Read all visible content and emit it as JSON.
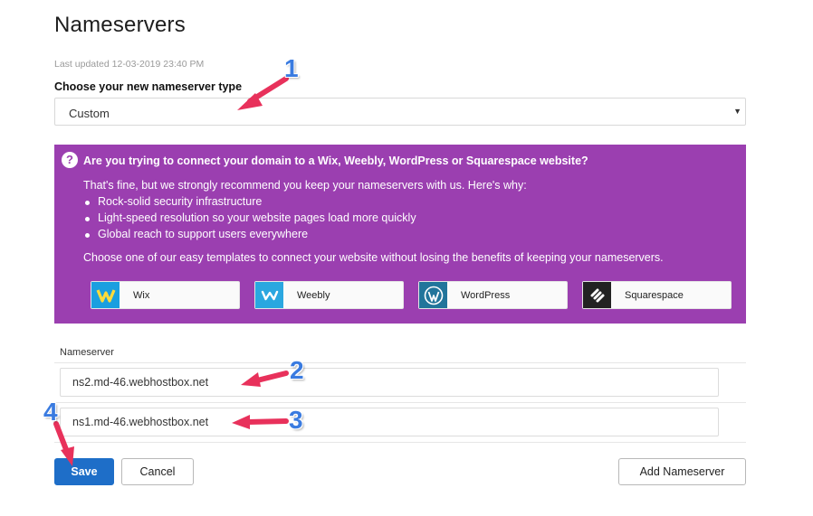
{
  "page": {
    "title": "Nameservers",
    "last_updated": "Last updated 12-03-2019 23:40 PM"
  },
  "nameserver_type": {
    "label": "Choose your new nameserver type",
    "selected": "Custom"
  },
  "promo": {
    "title": "Are you trying to connect your domain to a Wix, Weebly, WordPress or Squarespace website?",
    "intro": "That's fine, but we strongly recommend you keep your nameservers with us. Here's why:",
    "bullets": [
      "Rock-solid security infrastructure",
      "Light-speed resolution so your website pages load more quickly",
      "Global reach to support users everywhere"
    ],
    "choose_text": "Choose one of our easy templates to connect your website without losing the benefits of keeping your nameservers.",
    "templates": [
      {
        "label": "Wix",
        "icon": "wix-icon",
        "color": "#1a9fe0"
      },
      {
        "label": "Weebly",
        "icon": "weebly-icon",
        "color": "#2aa7e0"
      },
      {
        "label": "WordPress",
        "icon": "wordpress-icon",
        "color": "#21759b"
      },
      {
        "label": "Squarespace",
        "icon": "squarespace-icon",
        "color": "#222222"
      }
    ]
  },
  "nameservers": {
    "label": "Nameserver",
    "values": [
      "ns2.md-46.webhostbox.net",
      "ns1.md-46.webhostbox.net"
    ]
  },
  "buttons": {
    "save": "Save",
    "cancel": "Cancel",
    "add": "Add Nameserver"
  },
  "annotations": [
    "1",
    "2",
    "3",
    "4"
  ],
  "colors": {
    "promo_bg": "#9b3fb0",
    "primary": "#1e6ec8",
    "annotation_number": "#3a7be0",
    "annotation_arrow": "#e8315b"
  }
}
